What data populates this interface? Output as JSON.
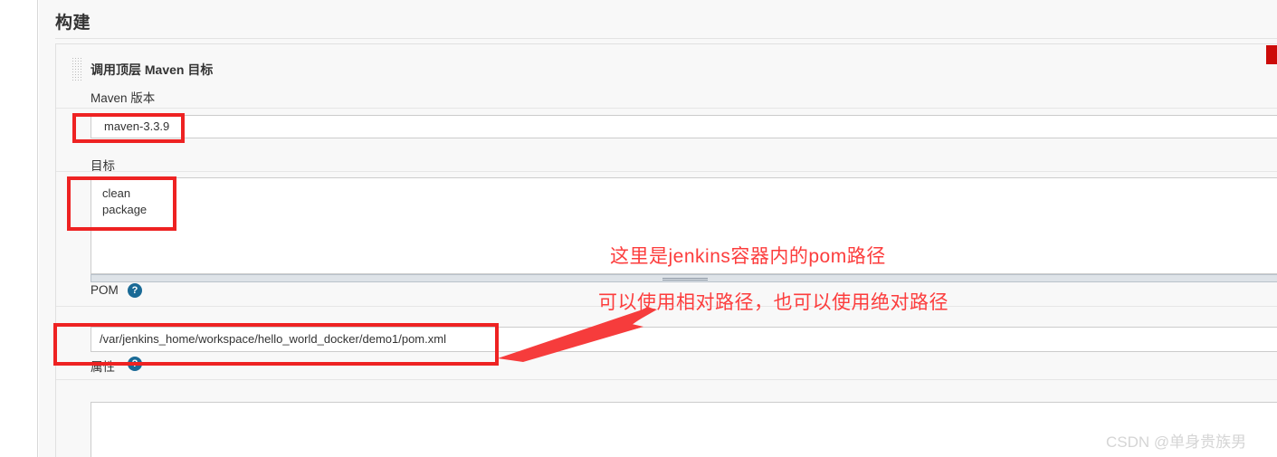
{
  "page": {
    "section_title": "构建",
    "builder_heading": "调用顶层 Maven 目标",
    "drag_handle_icon": "grip-dots-icon",
    "watermark": "CSDN @单身贵族男"
  },
  "fields": {
    "maven_version": {
      "label": "Maven 版本",
      "value": "maven-3.3.9",
      "control": "select"
    },
    "goals": {
      "label": "目标",
      "value": "clean\npackage",
      "control": "textarea"
    },
    "pom": {
      "label": "POM",
      "value": "/var/jenkins_home/workspace/hello_world_docker/demo1/pom.xml",
      "control": "text-input",
      "help_icon": "help-circle-icon",
      "help_glyph": "?"
    },
    "properties": {
      "label": "属性",
      "value": "",
      "control": "textarea",
      "help_icon": "help-circle-icon",
      "help_glyph": "?"
    }
  },
  "annotations": {
    "note_line_1": "这里是jenkins容器内的pom路径",
    "note_line_2": "可以使用相对路径，也可以使用绝对路径",
    "accent_color": "#fc3d3d",
    "box_color": "#ee2222",
    "tab_color": "#cc0b09"
  }
}
